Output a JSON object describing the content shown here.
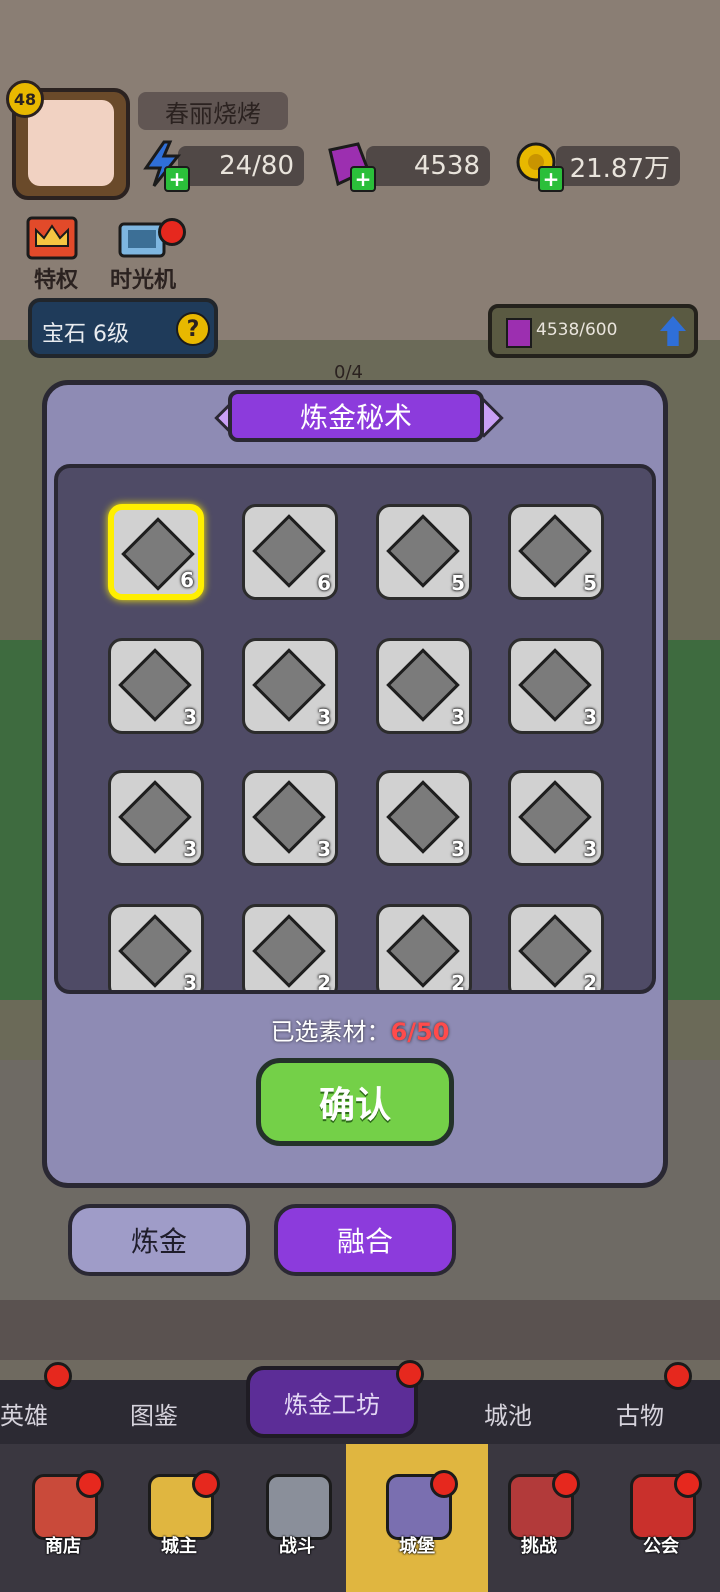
{
  "player": {
    "level": "48",
    "name": "春丽烧烤"
  },
  "resources": {
    "energy": "24/80",
    "gems": "4538",
    "gold": "21.87万"
  },
  "side_buttons": [
    {
      "label": "特权",
      "icon": "crown-icon"
    },
    {
      "label": "时光机",
      "icon": "time-machine-icon"
    }
  ],
  "gem_panel": {
    "label": "宝石  6级",
    "help": "?",
    "progress": "4538/600"
  },
  "background_counter": "0/4",
  "modal": {
    "title": "炼金秘术",
    "grid_items": [
      {
        "count": "6",
        "selected": true
      },
      {
        "count": "6",
        "selected": false
      },
      {
        "count": "5",
        "selected": false
      },
      {
        "count": "5",
        "selected": false
      },
      {
        "count": "3",
        "selected": false
      },
      {
        "count": "3",
        "selected": false
      },
      {
        "count": "3",
        "selected": false
      },
      {
        "count": "3",
        "selected": false
      },
      {
        "count": "3",
        "selected": false
      },
      {
        "count": "3",
        "selected": false
      },
      {
        "count": "3",
        "selected": false
      },
      {
        "count": "3",
        "selected": false
      },
      {
        "count": "3",
        "selected": false
      },
      {
        "count": "2",
        "selected": false
      },
      {
        "count": "2",
        "selected": false
      },
      {
        "count": "2",
        "selected": false
      }
    ],
    "selected_label": "已选素材：",
    "selected_value": "6/50",
    "confirm_label": "确认"
  },
  "segmented": {
    "left": "炼金",
    "right": "融合",
    "active": "融合"
  },
  "subnav": {
    "items": [
      "英雄",
      "图鉴",
      "炼金工坊",
      "城池",
      "古物"
    ],
    "active": "炼金工坊"
  },
  "bottom_nav": {
    "items": [
      {
        "label": "商店",
        "icon": "shop-icon"
      },
      {
        "label": "城主",
        "icon": "lord-icon"
      },
      {
        "label": "战斗",
        "icon": "swords-icon"
      },
      {
        "label": "城堡",
        "icon": "castle-icon"
      },
      {
        "label": "挑战",
        "icon": "challenge-icon"
      },
      {
        "label": "公会",
        "icon": "guild-icon"
      }
    ],
    "active": "城堡"
  },
  "colors": {
    "modal_bg": "#8e8bb4",
    "title_purple": "#8c3bdc",
    "confirm_green": "#74d048",
    "highlight_yellow": "#ffef00",
    "count_red": "#ff4b4b"
  }
}
